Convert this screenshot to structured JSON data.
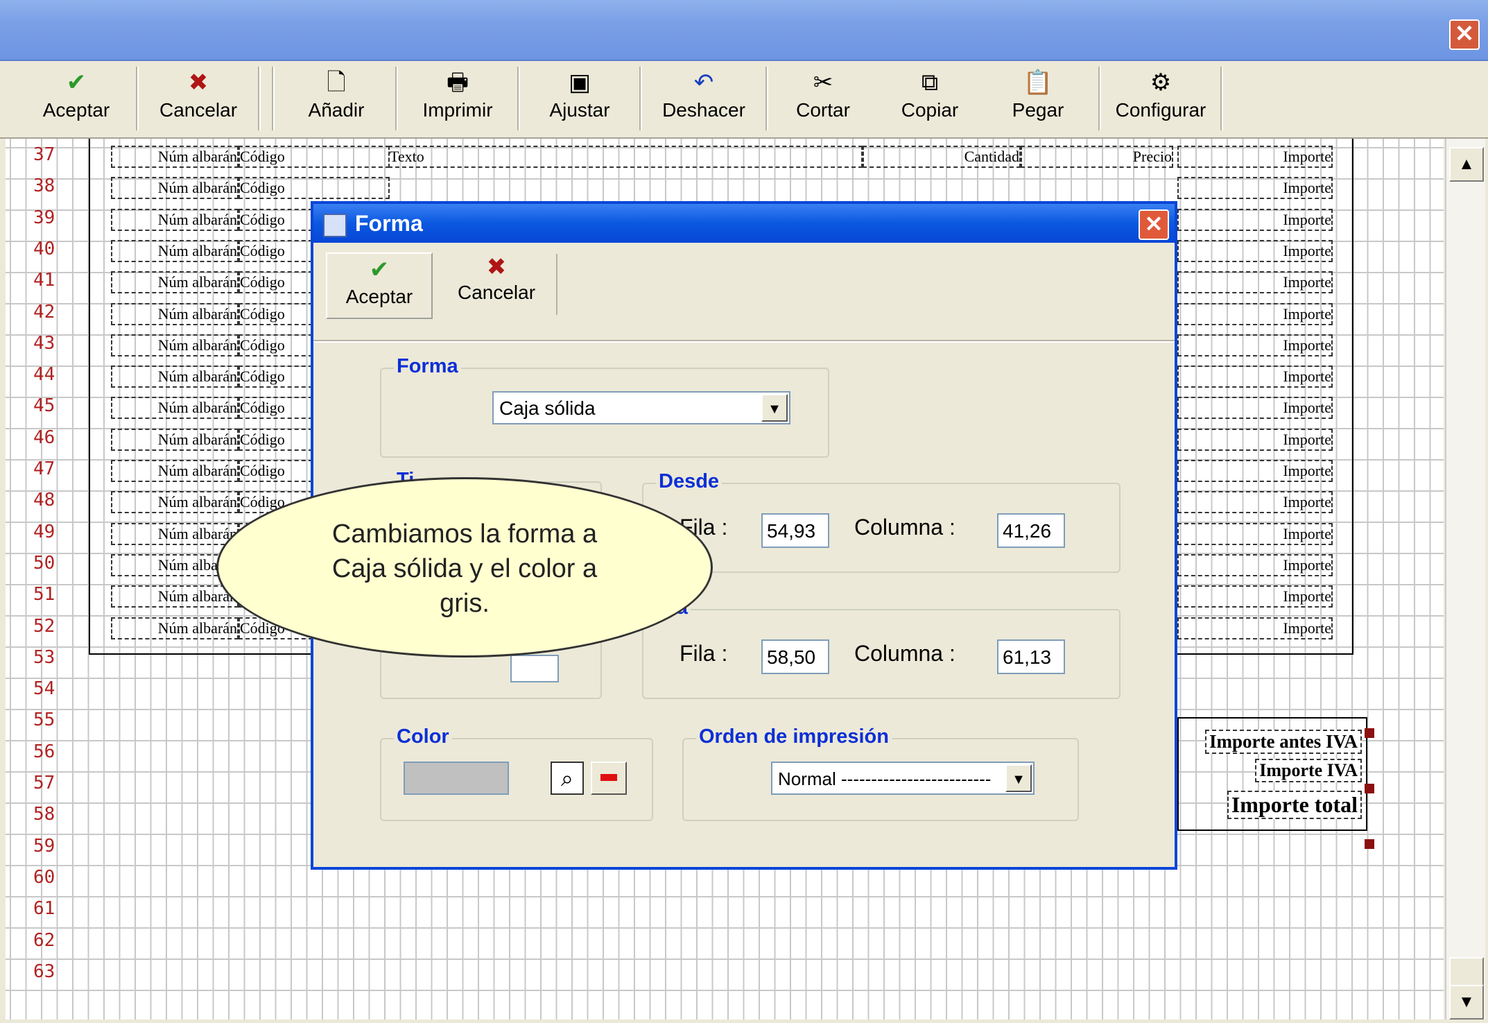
{
  "window": {
    "close_glyph": "✕"
  },
  "toolbar": {
    "items": [
      {
        "label": "Aceptar",
        "icon": "✔",
        "color": "#2c9a2c"
      },
      {
        "label": "Cancelar",
        "icon": "✖",
        "color": "#b01515"
      },
      {
        "label": "Añadir",
        "icon": "🗋",
        "color": "#000000"
      },
      {
        "label": "Imprimir",
        "icon": "🖶",
        "color": "#000000"
      },
      {
        "label": "Ajustar",
        "icon": "▣",
        "color": "#000000"
      },
      {
        "label": "Deshacer",
        "icon": "↶",
        "color": "#1a3fbf"
      },
      {
        "label": "Cortar",
        "icon": "✂",
        "color": "#000000"
      },
      {
        "label": "Copiar",
        "icon": "⧉",
        "color": "#000000"
      },
      {
        "label": "Pegar",
        "icon": "📋",
        "color": "#000000"
      },
      {
        "label": "Configurar",
        "icon": "⚙",
        "color": "#000000"
      }
    ]
  },
  "report": {
    "row_numbers": [
      "37",
      "38",
      "39",
      "40",
      "41",
      "42",
      "43",
      "44",
      "45",
      "46",
      "47",
      "48",
      "49",
      "50",
      "51",
      "52",
      "53",
      "54",
      "55",
      "56",
      "57",
      "58",
      "59",
      "60",
      "61",
      "62",
      "63"
    ],
    "col_albaran": "Núm albarán",
    "col_codigo": "Código",
    "col_texto": "Texto",
    "col_cantidad": "Cantidad",
    "col_precio": "Precio",
    "col_importe": "Importe",
    "totals": {
      "antes_iva": "Importe antes IVA",
      "iva": "Importe IVA",
      "total": "Importe total"
    }
  },
  "dialog": {
    "title": "Forma",
    "close_glyph": "✕",
    "accept_label": "Aceptar",
    "accept_icon": "✔",
    "cancel_label": "Cancelar",
    "cancel_icon": "✖",
    "forma_group": "Forma",
    "forma_value": "Caja sólida",
    "tipo_group": "Ti",
    "desde_group": "Desde",
    "hasta_group": "sta",
    "fila_label": "Fila :",
    "columna_label": "Columna :",
    "desde_fila": "54,93",
    "desde_columna": "41,26",
    "hasta_fila": "58,50",
    "hasta_columna": "61,13",
    "color_group": "Color",
    "color_value": "#c0c0c0",
    "orden_group": "Orden de impresión",
    "orden_value": "Normal -------------------------",
    "dropdown_glyph": "▼"
  },
  "callout": {
    "line1": "Cambiamos la forma a",
    "line2": "Caja sólida y el color a",
    "line3": "gris."
  },
  "scrollbar": {
    "up_glyph": "▲",
    "down_glyph": "▼"
  }
}
